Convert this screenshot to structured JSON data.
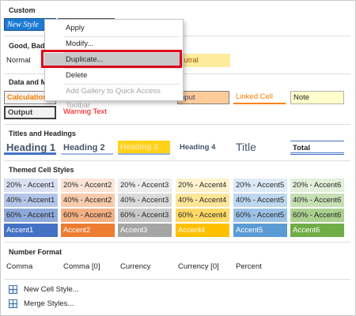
{
  "sections": {
    "custom": "Custom",
    "good_bad": "Good, Bad a",
    "data_model": "Data and Mo",
    "titles": "Titles and Headings",
    "themed": "Themed Cell Styles",
    "number": "Number Format"
  },
  "custom": {
    "new_style": "New Style"
  },
  "good_bad": {
    "normal": "Normal",
    "neutral": "eutral"
  },
  "data_model": {
    "calculation": "Calculation",
    "input": "nput",
    "linked": "Linked Cell",
    "note": "Note",
    "output": "Output",
    "warning": "Warning Text"
  },
  "headings": {
    "h1": "Heading 1",
    "h2": "Heading 2",
    "h3": "Heading 3",
    "h4": "Heading 4",
    "title": "Title",
    "total": "Total"
  },
  "themed": {
    "row20": [
      "20% - Accent1",
      "20% - Accent2",
      "20% - Accent3",
      "20% - Accent4",
      "20% - Accent5",
      "20% - Accent6"
    ],
    "row40": [
      "40% - Accent1",
      "40% - Accent2",
      "40% - Accent3",
      "40% - Accent4",
      "40% - Accent5",
      "40% - Accent6"
    ],
    "row60": [
      "60% - Accent1",
      "60% - Accent2",
      "60% - Accent3",
      "60% - Accent4",
      "60% - Accent5",
      "60% - Accent6"
    ],
    "accent": [
      "Accent1",
      "Accent2",
      "Accent3",
      "Accent4",
      "Accent5",
      "Accent6"
    ]
  },
  "number_format": [
    "Comma",
    "Comma [0]",
    "Currency",
    "Currency [0]",
    "Percent"
  ],
  "commands": {
    "new_cell_style": "New Cell Style...",
    "merge_styles": "Merge Styles..."
  },
  "context_menu": {
    "apply": "Apply",
    "modify": "Modify...",
    "duplicate": "Duplicate...",
    "delete": "Delete",
    "add_gallery": "Add Gallery to Quick Access Toolbar"
  },
  "colors": {
    "accent1": "#4472c4",
    "accent2": "#ed7d31",
    "accent3": "#a5a5a5",
    "accent4": "#ffc000",
    "accent5": "#5b9bd5",
    "accent6": "#70ad47",
    "highlight": "#e0001a"
  }
}
